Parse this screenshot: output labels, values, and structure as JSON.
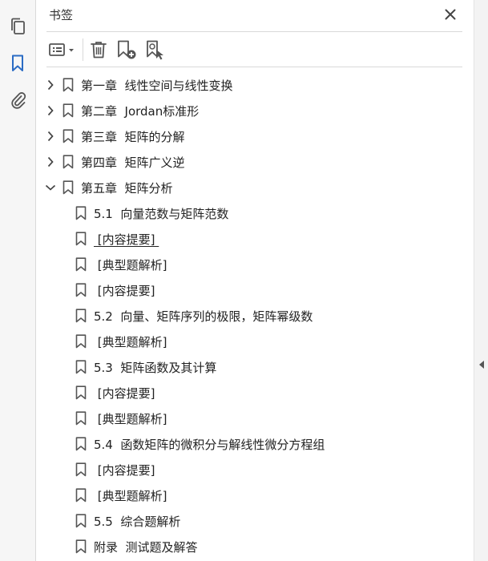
{
  "panel": {
    "title": "书签"
  },
  "left_rail": {
    "icons": [
      "pages-icon",
      "bookmarks-icon",
      "attachments-icon"
    ],
    "active": "bookmarks-icon"
  },
  "toolbar": {
    "icons": [
      "options-menu-icon",
      "delete-icon",
      "new-bookmark-icon",
      "new-bookmark-from-structure-icon"
    ]
  },
  "colors": {
    "accent": "#2b6cc4",
    "icon": "#555555",
    "divider": "#d9d9d9"
  },
  "bookmarks": [
    {
      "label": "第一章  线性空间与线性变换",
      "expander": "collapsed"
    },
    {
      "label": "第二章  Jordan标准形",
      "expander": "collapsed"
    },
    {
      "label": "第三章  矩阵的分解",
      "expander": "collapsed"
    },
    {
      "label": "第四章  矩阵广义逆",
      "expander": "collapsed"
    },
    {
      "label": "第五章  矩阵分析",
      "expander": "expanded"
    },
    {
      "label": "5.1  向量范数与矩阵范数",
      "child": true
    },
    {
      "label": " [内容提要] ",
      "child": true,
      "underlined": true
    },
    {
      "label": " [典型题解析]",
      "child": true
    },
    {
      "label": " [内容提要]",
      "child": true
    },
    {
      "label": "5.2  向量、矩阵序列的极限，矩阵幂级数",
      "child": true
    },
    {
      "label": " [典型题解析]",
      "child": true
    },
    {
      "label": "5.3  矩阵函数及其计算",
      "child": true
    },
    {
      "label": " [内容提要]",
      "child": true
    },
    {
      "label": " [典型题解析]",
      "child": true
    },
    {
      "label": "5.4  函数矩阵的微积分与解线性微分方程组",
      "child": true
    },
    {
      "label": " [内容提要]",
      "child": true
    },
    {
      "label": " [典型题解析]",
      "child": true
    },
    {
      "label": "5.5  综合题解析",
      "child": true
    },
    {
      "label": "附录  测试题及解答",
      "child": true
    }
  ]
}
